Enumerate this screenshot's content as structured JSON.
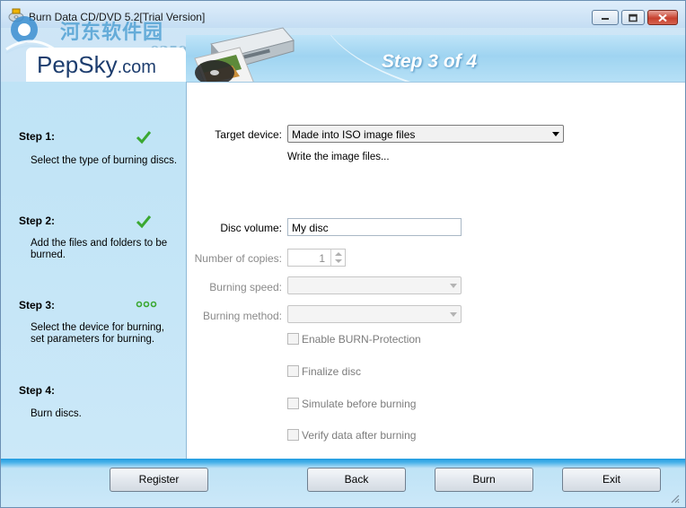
{
  "window": {
    "title": "Burn Data CD/DVD 5.2[Trial Version]"
  },
  "watermark": {
    "site_cn": "河东软件园",
    "site_url": "www.pc0359.cn",
    "brand_main": "PepSky",
    "brand_suffix": ".com"
  },
  "banner": {
    "step_title": "Step 3 of 4"
  },
  "steps": [
    {
      "head": "Step 1:",
      "desc": "Select the type of burning discs.",
      "status": "done-check-icon"
    },
    {
      "head": "Step 2:",
      "desc": "Add the files and folders to be burned.",
      "status": "done-check-icon"
    },
    {
      "head": "Step 3:",
      "desc": "Select the device for burning, set parameters for burning.",
      "status": "in-progress-dots-icon"
    },
    {
      "head": "Step 4:",
      "desc": "Burn discs.",
      "status": ""
    }
  ],
  "form": {
    "target_device_label": "Target device:",
    "target_device_value": "Made into ISO image files",
    "target_device_info": "Write the image files...",
    "disc_volume_label": "Disc volume:",
    "disc_volume_value": "My disc",
    "copies_label": "Number of copies:",
    "copies_value": "1",
    "burning_speed_label": "Burning speed:",
    "burning_speed_value": "",
    "burning_method_label": "Burning method:",
    "burning_method_value": "",
    "checkboxes": [
      {
        "label": "Enable BURN-Protection",
        "checked": false
      },
      {
        "label": "Finalize disc",
        "checked": false
      },
      {
        "label": "Simulate before burning",
        "checked": false
      },
      {
        "label": "Verify data after burning",
        "checked": false
      }
    ]
  },
  "buttons": {
    "register": "Register",
    "back": "Back",
    "burn": "Burn",
    "exit": "Exit"
  },
  "colors": {
    "banner_blue": "#9fd4f1",
    "check_green": "#3aa831",
    "bottom_bar_blue": "#1f9be0",
    "disabled_text": "#8a8a8a"
  }
}
